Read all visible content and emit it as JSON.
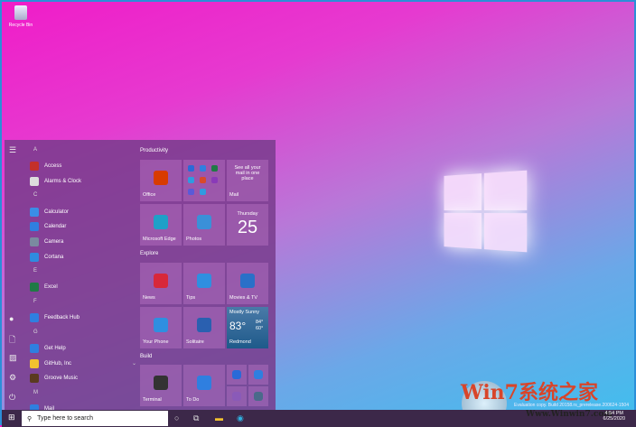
{
  "desktop": {
    "recycle_bin": "Recycle Bin"
  },
  "start": {
    "apps": [
      {
        "letter": "A"
      },
      {
        "name": "Access",
        "color": "#c4302b"
      },
      {
        "name": "Alarms & Clock",
        "color": "#ddd"
      },
      {
        "letter": "C"
      },
      {
        "name": "Calculator",
        "color": "#3a8ee6"
      },
      {
        "name": "Calendar",
        "color": "#2f7fe0"
      },
      {
        "name": "Camera",
        "color": "#7a8aa0"
      },
      {
        "name": "Cortana",
        "color": "#2e8be0"
      },
      {
        "letter": "E"
      },
      {
        "name": "Excel",
        "color": "#1f7a45"
      },
      {
        "letter": "F"
      },
      {
        "name": "Feedback Hub",
        "color": "#2f7fe0"
      },
      {
        "letter": "G"
      },
      {
        "name": "Get Help",
        "color": "#2f7fe0"
      },
      {
        "name": "GitHub, Inc",
        "color": "#f2c230",
        "expand": "⌄"
      },
      {
        "name": "Groove Music",
        "color": "#5a3a20"
      },
      {
        "letter": "M"
      },
      {
        "name": "Mail",
        "color": "#2f7fe0"
      }
    ],
    "groups": [
      "Productivity",
      "Explore",
      "Build"
    ],
    "tiles": [
      {
        "label": "Office",
        "color": "#d83b01"
      },
      {
        "label": "",
        "color": ""
      },
      {
        "label": "Mail",
        "text": "See all your mail in one place",
        "color": "#2f9be0"
      },
      {
        "label": "Microsoft Edge",
        "color": "#1ea0c8"
      },
      {
        "label": "Photos",
        "color": "#3a90d8"
      },
      {
        "label": "",
        "weekday": "Thursday",
        "day": "25"
      },
      {
        "label": "News",
        "color": "#d8283a"
      },
      {
        "label": "Tips",
        "color": "#2f8fe0"
      },
      {
        "label": "Movies & TV",
        "color": "#2a70c8"
      },
      {
        "label": "Your Phone",
        "color": "#2f8fe0"
      },
      {
        "label": "Solitaire",
        "color": "#2a60b0"
      },
      {
        "label": "Redmond",
        "weather": "Mostly Sunny",
        "temp": "83°",
        "hi": "84°",
        "lo": "60°"
      },
      {
        "label": "Terminal",
        "color": "#333"
      },
      {
        "label": "To Do",
        "color": "#2f7fe0"
      }
    ]
  },
  "taskbar": {
    "search_placeholder": "Type here to search",
    "time": "4:54 PM",
    "date": "6/25/2020"
  },
  "watermark": {
    "title": "Win7系统之家",
    "url": "Www.Winwin7.com",
    "eval": "Evaluation copy. Build 20158.rs_prerelease.200624-1504"
  }
}
